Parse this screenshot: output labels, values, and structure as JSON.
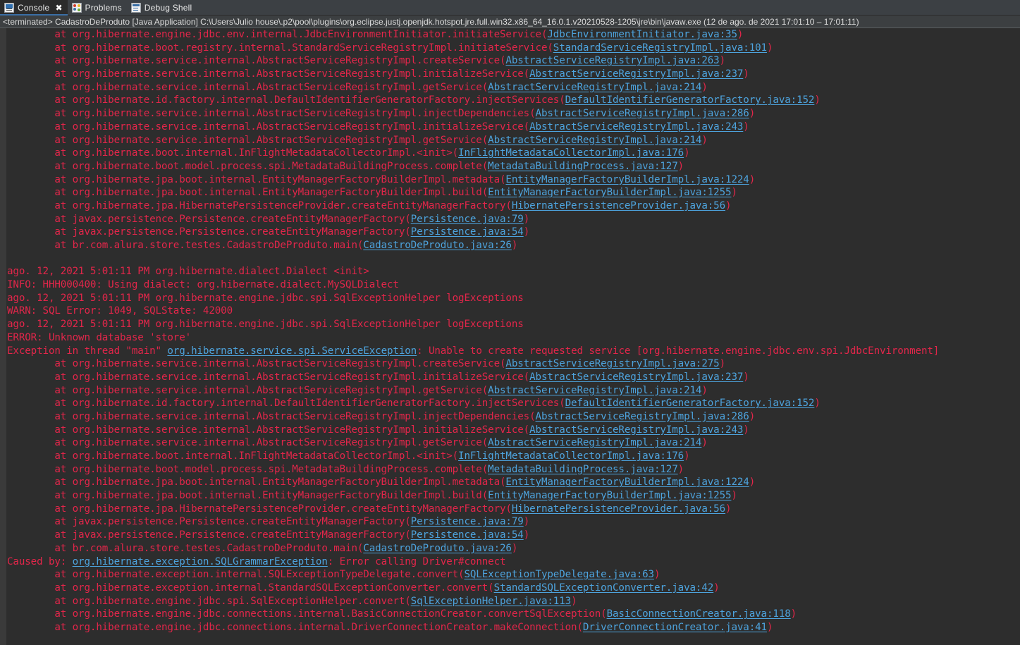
{
  "window": {
    "background": "#2d2d2d",
    "text_color": "#e2264a",
    "link_color": "#4da3dd"
  },
  "tabs": [
    {
      "label": "Console",
      "icon": "console-icon",
      "active": true,
      "closable": true,
      "close_glyph": "✖"
    },
    {
      "label": "Problems",
      "icon": "problems-icon",
      "active": false,
      "closable": false
    },
    {
      "label": "Debug Shell",
      "icon": "debug-shell-icon",
      "active": false,
      "closable": false
    }
  ],
  "process_line": "<terminated> CadastroDeProduto [Java Application] C:\\Users\\Julio house\\.p2\\pool\\plugins\\org.eclipse.justj.openjdk.hotspot.jre.full.win32.x86_64_16.0.1.v20210528-1205\\jre\\bin\\javaw.exe  (12 de ago. de 2021 17:01:10 – 17:01:11)",
  "console_lines": [
    [
      {
        "t": "        at org.hibernate.engine.jdbc.env.internal.JdbcEnvironmentInitiator.initiateService("
      },
      {
        "t": "JdbcEnvironmentInitiator.java:35",
        "link": true
      },
      {
        "t": ")"
      }
    ],
    [
      {
        "t": "        at org.hibernate.boot.registry.internal.StandardServiceRegistryImpl.initiateService("
      },
      {
        "t": "StandardServiceRegistryImpl.java:101",
        "link": true
      },
      {
        "t": ")"
      }
    ],
    [
      {
        "t": "        at org.hibernate.service.internal.AbstractServiceRegistryImpl.createService("
      },
      {
        "t": "AbstractServiceRegistryImpl.java:263",
        "link": true
      },
      {
        "t": ")"
      }
    ],
    [
      {
        "t": "        at org.hibernate.service.internal.AbstractServiceRegistryImpl.initializeService("
      },
      {
        "t": "AbstractServiceRegistryImpl.java:237",
        "link": true
      },
      {
        "t": ")"
      }
    ],
    [
      {
        "t": "        at org.hibernate.service.internal.AbstractServiceRegistryImpl.getService("
      },
      {
        "t": "AbstractServiceRegistryImpl.java:214",
        "link": true
      },
      {
        "t": ")"
      }
    ],
    [
      {
        "t": "        at org.hibernate.id.factory.internal.DefaultIdentifierGeneratorFactory.injectServices("
      },
      {
        "t": "DefaultIdentifierGeneratorFactory.java:152",
        "link": true
      },
      {
        "t": ")"
      }
    ],
    [
      {
        "t": "        at org.hibernate.service.internal.AbstractServiceRegistryImpl.injectDependencies("
      },
      {
        "t": "AbstractServiceRegistryImpl.java:286",
        "link": true
      },
      {
        "t": ")"
      }
    ],
    [
      {
        "t": "        at org.hibernate.service.internal.AbstractServiceRegistryImpl.initializeService("
      },
      {
        "t": "AbstractServiceRegistryImpl.java:243",
        "link": true
      },
      {
        "t": ")"
      }
    ],
    [
      {
        "t": "        at org.hibernate.service.internal.AbstractServiceRegistryImpl.getService("
      },
      {
        "t": "AbstractServiceRegistryImpl.java:214",
        "link": true
      },
      {
        "t": ")"
      }
    ],
    [
      {
        "t": "        at org.hibernate.boot.internal.InFlightMetadataCollectorImpl.<init>("
      },
      {
        "t": "InFlightMetadataCollectorImpl.java:176",
        "link": true
      },
      {
        "t": ")"
      }
    ],
    [
      {
        "t": "        at org.hibernate.boot.model.process.spi.MetadataBuildingProcess.complete("
      },
      {
        "t": "MetadataBuildingProcess.java:127",
        "link": true
      },
      {
        "t": ")"
      }
    ],
    [
      {
        "t": "        at org.hibernate.jpa.boot.internal.EntityManagerFactoryBuilderImpl.metadata("
      },
      {
        "t": "EntityManagerFactoryBuilderImpl.java:1224",
        "link": true
      },
      {
        "t": ")"
      }
    ],
    [
      {
        "t": "        at org.hibernate.jpa.boot.internal.EntityManagerFactoryBuilderImpl.build("
      },
      {
        "t": "EntityManagerFactoryBuilderImpl.java:1255",
        "link": true
      },
      {
        "t": ")"
      }
    ],
    [
      {
        "t": "        at org.hibernate.jpa.HibernatePersistenceProvider.createEntityManagerFactory("
      },
      {
        "t": "HibernatePersistenceProvider.java:56",
        "link": true
      },
      {
        "t": ")"
      }
    ],
    [
      {
        "t": "        at javax.persistence.Persistence.createEntityManagerFactory("
      },
      {
        "t": "Persistence.java:79",
        "link": true
      },
      {
        "t": ")"
      }
    ],
    [
      {
        "t": "        at javax.persistence.Persistence.createEntityManagerFactory("
      },
      {
        "t": "Persistence.java:54",
        "link": true
      },
      {
        "t": ")"
      }
    ],
    [
      {
        "t": "        at br.com.alura.store.testes.CadastroDeProduto.main("
      },
      {
        "t": "CadastroDeProduto.java:26",
        "link": true
      },
      {
        "t": ")"
      }
    ],
    [
      {
        "t": ""
      }
    ],
    [
      {
        "t": "ago. 12, 2021 5:01:11 PM org.hibernate.dialect.Dialect <init>"
      }
    ],
    [
      {
        "t": "INFO: HHH000400: Using dialect: org.hibernate.dialect.MySQLDialect"
      }
    ],
    [
      {
        "t": "ago. 12, 2021 5:01:11 PM org.hibernate.engine.jdbc.spi.SqlExceptionHelper logExceptions"
      }
    ],
    [
      {
        "t": "WARN: SQL Error: 1049, SQLState: 42000"
      }
    ],
    [
      {
        "t": "ago. 12, 2021 5:01:11 PM org.hibernate.engine.jdbc.spi.SqlExceptionHelper logExceptions"
      }
    ],
    [
      {
        "t": "ERROR: Unknown database 'store'"
      }
    ],
    [
      {
        "t": "Exception in thread \"main\" "
      },
      {
        "t": "org.hibernate.service.spi.ServiceException",
        "link": true
      },
      {
        "t": ": Unable to create requested service [org.hibernate.engine.jdbc.env.spi.JdbcEnvironment]"
      }
    ],
    [
      {
        "t": "        at org.hibernate.service.internal.AbstractServiceRegistryImpl.createService("
      },
      {
        "t": "AbstractServiceRegistryImpl.java:275",
        "link": true
      },
      {
        "t": ")"
      }
    ],
    [
      {
        "t": "        at org.hibernate.service.internal.AbstractServiceRegistryImpl.initializeService("
      },
      {
        "t": "AbstractServiceRegistryImpl.java:237",
        "link": true
      },
      {
        "t": ")"
      }
    ],
    [
      {
        "t": "        at org.hibernate.service.internal.AbstractServiceRegistryImpl.getService("
      },
      {
        "t": "AbstractServiceRegistryImpl.java:214",
        "link": true
      },
      {
        "t": ")"
      }
    ],
    [
      {
        "t": "        at org.hibernate.id.factory.internal.DefaultIdentifierGeneratorFactory.injectServices("
      },
      {
        "t": "DefaultIdentifierGeneratorFactory.java:152",
        "link": true
      },
      {
        "t": ")"
      }
    ],
    [
      {
        "t": "        at org.hibernate.service.internal.AbstractServiceRegistryImpl.injectDependencies("
      },
      {
        "t": "AbstractServiceRegistryImpl.java:286",
        "link": true
      },
      {
        "t": ")"
      }
    ],
    [
      {
        "t": "        at org.hibernate.service.internal.AbstractServiceRegistryImpl.initializeService("
      },
      {
        "t": "AbstractServiceRegistryImpl.java:243",
        "link": true
      },
      {
        "t": ")"
      }
    ],
    [
      {
        "t": "        at org.hibernate.service.internal.AbstractServiceRegistryImpl.getService("
      },
      {
        "t": "AbstractServiceRegistryImpl.java:214",
        "link": true
      },
      {
        "t": ")"
      }
    ],
    [
      {
        "t": "        at org.hibernate.boot.internal.InFlightMetadataCollectorImpl.<init>("
      },
      {
        "t": "InFlightMetadataCollectorImpl.java:176",
        "link": true
      },
      {
        "t": ")"
      }
    ],
    [
      {
        "t": "        at org.hibernate.boot.model.process.spi.MetadataBuildingProcess.complete("
      },
      {
        "t": "MetadataBuildingProcess.java:127",
        "link": true
      },
      {
        "t": ")"
      }
    ],
    [
      {
        "t": "        at org.hibernate.jpa.boot.internal.EntityManagerFactoryBuilderImpl.metadata("
      },
      {
        "t": "EntityManagerFactoryBuilderImpl.java:1224",
        "link": true
      },
      {
        "t": ")"
      }
    ],
    [
      {
        "t": "        at org.hibernate.jpa.boot.internal.EntityManagerFactoryBuilderImpl.build("
      },
      {
        "t": "EntityManagerFactoryBuilderImpl.java:1255",
        "link": true
      },
      {
        "t": ")"
      }
    ],
    [
      {
        "t": "        at org.hibernate.jpa.HibernatePersistenceProvider.createEntityManagerFactory("
      },
      {
        "t": "HibernatePersistenceProvider.java:56",
        "link": true
      },
      {
        "t": ")"
      }
    ],
    [
      {
        "t": "        at javax.persistence.Persistence.createEntityManagerFactory("
      },
      {
        "t": "Persistence.java:79",
        "link": true
      },
      {
        "t": ")"
      }
    ],
    [
      {
        "t": "        at javax.persistence.Persistence.createEntityManagerFactory("
      },
      {
        "t": "Persistence.java:54",
        "link": true
      },
      {
        "t": ")"
      }
    ],
    [
      {
        "t": "        at br.com.alura.store.testes.CadastroDeProduto.main("
      },
      {
        "t": "CadastroDeProduto.java:26",
        "link": true
      },
      {
        "t": ")"
      }
    ],
    [
      {
        "t": "Caused by: "
      },
      {
        "t": "org.hibernate.exception.SQLGrammarException",
        "link": true
      },
      {
        "t": ": Error calling Driver#connect"
      }
    ],
    [
      {
        "t": "        at org.hibernate.exception.internal.SQLExceptionTypeDelegate.convert("
      },
      {
        "t": "SQLExceptionTypeDelegate.java:63",
        "link": true
      },
      {
        "t": ")"
      }
    ],
    [
      {
        "t": "        at org.hibernate.exception.internal.StandardSQLExceptionConverter.convert("
      },
      {
        "t": "StandardSQLExceptionConverter.java:42",
        "link": true
      },
      {
        "t": ")"
      }
    ],
    [
      {
        "t": "        at org.hibernate.engine.jdbc.spi.SqlExceptionHelper.convert("
      },
      {
        "t": "SqlExceptionHelper.java:113",
        "link": true
      },
      {
        "t": ")"
      }
    ],
    [
      {
        "t": "        at org.hibernate.engine.jdbc.connections.internal.BasicConnectionCreator.convertSqlException("
      },
      {
        "t": "BasicConnectionCreator.java:118",
        "link": true
      },
      {
        "t": ")"
      }
    ],
    [
      {
        "t": "        at org.hibernate.engine.jdbc.connections.internal.DriverConnectionCreator.makeConnection("
      },
      {
        "t": "DriverConnectionCreator.java:41",
        "link": true
      },
      {
        "t": ")"
      }
    ]
  ]
}
